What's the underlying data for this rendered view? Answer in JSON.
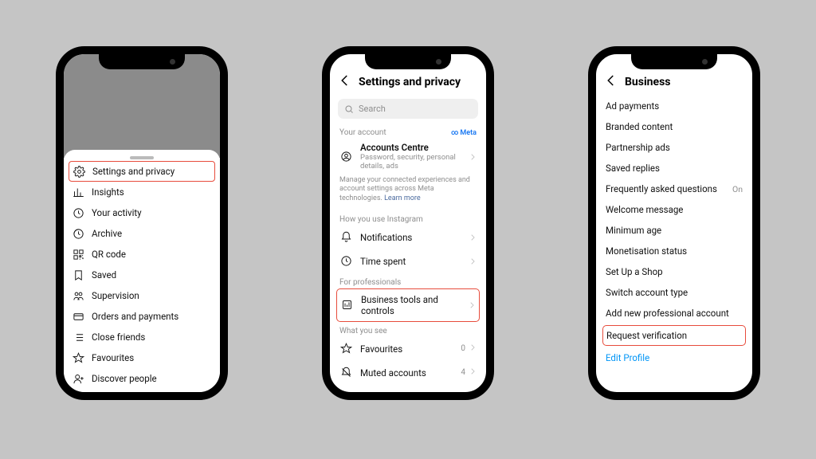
{
  "phone1": {
    "menu": [
      {
        "label": "Settings and privacy",
        "hl": true
      },
      {
        "label": "Insights"
      },
      {
        "label": "Your activity"
      },
      {
        "label": "Archive"
      },
      {
        "label": "QR code"
      },
      {
        "label": "Saved"
      },
      {
        "label": "Supervision"
      },
      {
        "label": "Orders and payments"
      },
      {
        "label": "Close friends"
      },
      {
        "label": "Favourites"
      },
      {
        "label": "Discover people"
      }
    ]
  },
  "phone2": {
    "title": "Settings and privacy",
    "search_placeholder": "Search",
    "your_account": "Your account",
    "meta": "Meta",
    "accounts_centre": "Accounts Centre",
    "accounts_sub": "Password, security, personal details, ads",
    "note": "Manage your connected experiences and account settings across Meta technologies.",
    "learn_more": "Learn more",
    "how_you_use": "How you use Instagram",
    "notifications": "Notifications",
    "time_spent": "Time spent",
    "for_pro": "For professionals",
    "business_tools": "Business tools and controls",
    "what_you_see": "What you see",
    "favourites": "Favourites",
    "fav_count": "0",
    "muted": "Muted accounts",
    "muted_count": "4"
  },
  "phone3": {
    "title": "Business",
    "items": [
      {
        "label": "Ad payments"
      },
      {
        "label": "Branded content"
      },
      {
        "label": "Partnership ads"
      },
      {
        "label": "Saved replies"
      },
      {
        "label": "Frequently asked questions",
        "value": "On"
      },
      {
        "label": "Welcome message"
      },
      {
        "label": "Minimum age"
      },
      {
        "label": "Monetisation status"
      },
      {
        "label": "Set Up a Shop"
      },
      {
        "label": "Switch account type"
      },
      {
        "label": "Add new professional account"
      },
      {
        "label": "Request verification",
        "hl": true
      },
      {
        "label": "Edit Profile",
        "link": true
      }
    ]
  }
}
